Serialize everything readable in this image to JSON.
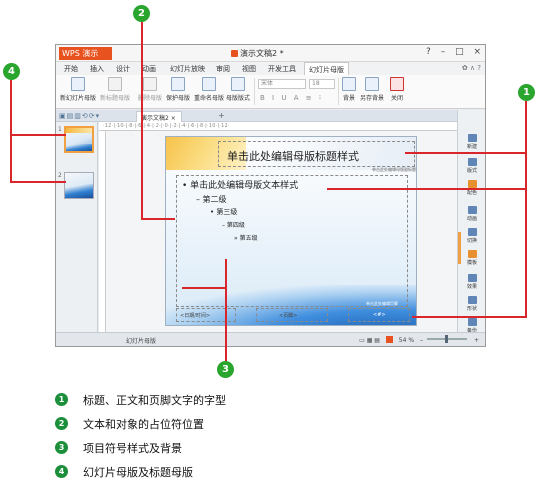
{
  "app": {
    "logo": "WPS 演示",
    "doc_title": "演示文稿2 *",
    "window_controls": [
      "?",
      "–",
      "□",
      "×"
    ]
  },
  "menu": {
    "items": [
      "开始",
      "插入",
      "设计",
      "动画",
      "幻灯片放映",
      "审阅",
      "视图",
      "开发工具",
      "幻灯片母版"
    ],
    "active": "幻灯片母版"
  },
  "ribbon": {
    "buttons": [
      {
        "label": "新幻灯片母版",
        "icon": "new-master-icon",
        "enabled": true
      },
      {
        "label": "新标题母版",
        "icon": "new-title-master-icon",
        "enabled": false
      },
      {
        "label": "删除母版",
        "icon": "delete-master-icon",
        "enabled": false
      },
      {
        "label": "保护母版",
        "icon": "protect-master-icon",
        "enabled": true
      },
      {
        "label": "重命名母版",
        "icon": "rename-master-icon",
        "enabled": true
      },
      {
        "label": "母版版式",
        "icon": "master-layout-icon",
        "enabled": true
      }
    ],
    "font_name": "宋体",
    "font_size": "18",
    "format_buttons": [
      "B",
      "I",
      "U",
      "A",
      "≡",
      "⁝"
    ],
    "right_buttons": [
      {
        "label": "背景",
        "icon": "background-icon"
      },
      {
        "label": "另存背景",
        "icon": "save-background-icon"
      },
      {
        "label": "关闭",
        "icon": "close-master-icon"
      }
    ]
  },
  "tab": {
    "label": "演示文稿2 ×",
    "add": "+"
  },
  "ruler_text": "·12·|·10·|·8·|·6·|·4·|·2·|·0·|·2·|·4·|·6·|·8·|·10·|·12·",
  "thumbnails": [
    "1",
    "2"
  ],
  "slide": {
    "title": "单击此处编辑母版标题样式",
    "subtitle_hint": "单击此处编辑母版副标题",
    "levels": [
      "• 单击此处编辑母版文本样式",
      "– 第二级",
      "• 第三级",
      "– 第四级",
      "» 第五级"
    ],
    "date": "<日期/时间>",
    "footer": "<页脚>",
    "number": "<#>",
    "footer_hint": "单击此处编辑页脚"
  },
  "taskpane": {
    "items": [
      {
        "label": "新建",
        "icon": "new-icon"
      },
      {
        "label": "版式",
        "icon": "layout-icon"
      },
      {
        "label": "配色",
        "icon": "color-scheme-icon"
      },
      {
        "label": "动画",
        "icon": "animation-icon"
      },
      {
        "label": "切换",
        "icon": "transition-icon"
      },
      {
        "label": "模板",
        "icon": "template-icon"
      },
      {
        "label": "效果",
        "icon": "effect-icon"
      },
      {
        "label": "形状",
        "icon": "shape-icon"
      },
      {
        "label": "备份",
        "icon": "backup-icon"
      }
    ]
  },
  "status": {
    "left": "幻灯片母版",
    "zoom": "54 %"
  },
  "callouts": [
    "1",
    "2",
    "3",
    "4"
  ],
  "legend": [
    {
      "num": "1",
      "text": "标题、正文和页脚文字的字型"
    },
    {
      "num": "2",
      "text": "文本和对象的占位符位置"
    },
    {
      "num": "3",
      "text": "项目符号样式及背景"
    },
    {
      "num": "4",
      "text": "幻灯片母版及标题母版"
    }
  ],
  "colors": {
    "callout_green": "#2aa52e",
    "leader_red": "#d8262b",
    "wps_orange": "#e8521f"
  }
}
